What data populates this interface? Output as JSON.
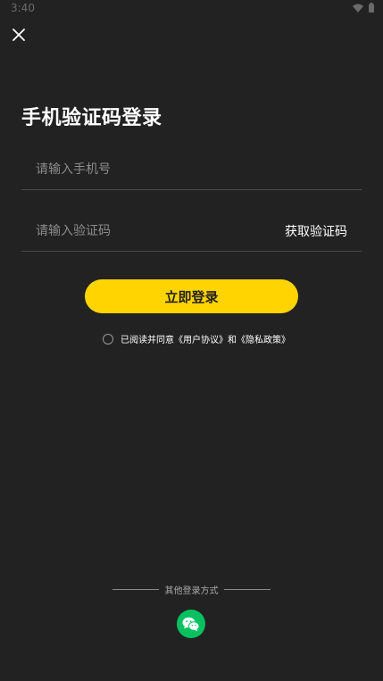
{
  "status_bar": {
    "time": "3:40"
  },
  "header": {
    "close_icon": "close-icon"
  },
  "page": {
    "title": "手机验证码登录"
  },
  "form": {
    "phone_placeholder": "请输入手机号",
    "code_placeholder": "请输入验证码",
    "get_code_label": "获取验证码",
    "login_label": "立即登录"
  },
  "agreement": {
    "prefix": "已阅读并同意",
    "user_agreement": "《用户协议》",
    "conjunction": "和",
    "privacy_policy": "《隐私政策》"
  },
  "other_login": {
    "label": "其他登录方式",
    "wechat_icon": "wechat-icon"
  },
  "colors": {
    "background": "#222222",
    "accent": "#ffd400",
    "wechat": "#07c160"
  }
}
